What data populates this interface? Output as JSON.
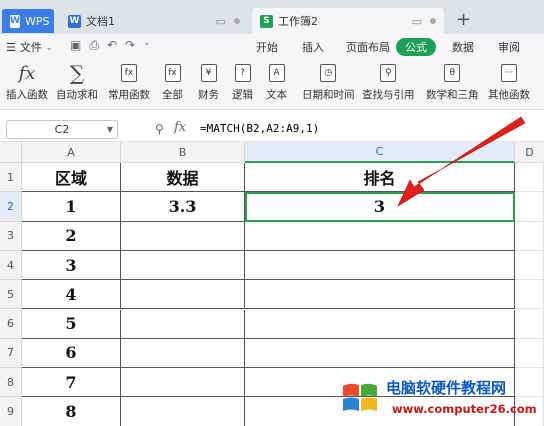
{
  "tabs": {
    "wps": "WPS",
    "doc": "文档1",
    "sheet": "工作簿2"
  },
  "menu": {
    "file": "文件",
    "items": [
      "开始",
      "插入",
      "页面布局",
      "公式",
      "数据",
      "审阅"
    ],
    "active": "公式"
  },
  "ribbon": {
    "buttons": [
      "插入函数",
      "自动求和",
      "常用函数",
      "全部",
      "财务",
      "逻辑",
      "文本",
      "日期和时间",
      "查找与引用",
      "数学和三角",
      "其他函数"
    ]
  },
  "formula_bar": {
    "cell_ref": "C2",
    "formula": "=MATCH(B2,A2:A9,1)"
  },
  "sheet": {
    "columns": [
      "A",
      "B",
      "C",
      "D"
    ],
    "rows": [
      "1",
      "2",
      "3",
      "4",
      "5",
      "6",
      "7",
      "8",
      "9"
    ],
    "headers": [
      "区域",
      "数据",
      "排名"
    ],
    "col_a": [
      "1",
      "2",
      "3",
      "4",
      "5",
      "6",
      "7",
      "8"
    ],
    "b2": "3.3",
    "c2": "3"
  },
  "watermark": {
    "title": "电脑软硬件教程网",
    "url": "www.computer26.com"
  },
  "colors": {
    "accent_green": "#1fa056",
    "wps_blue": "#3a7ee8",
    "arrow_red": "#e0201b"
  }
}
